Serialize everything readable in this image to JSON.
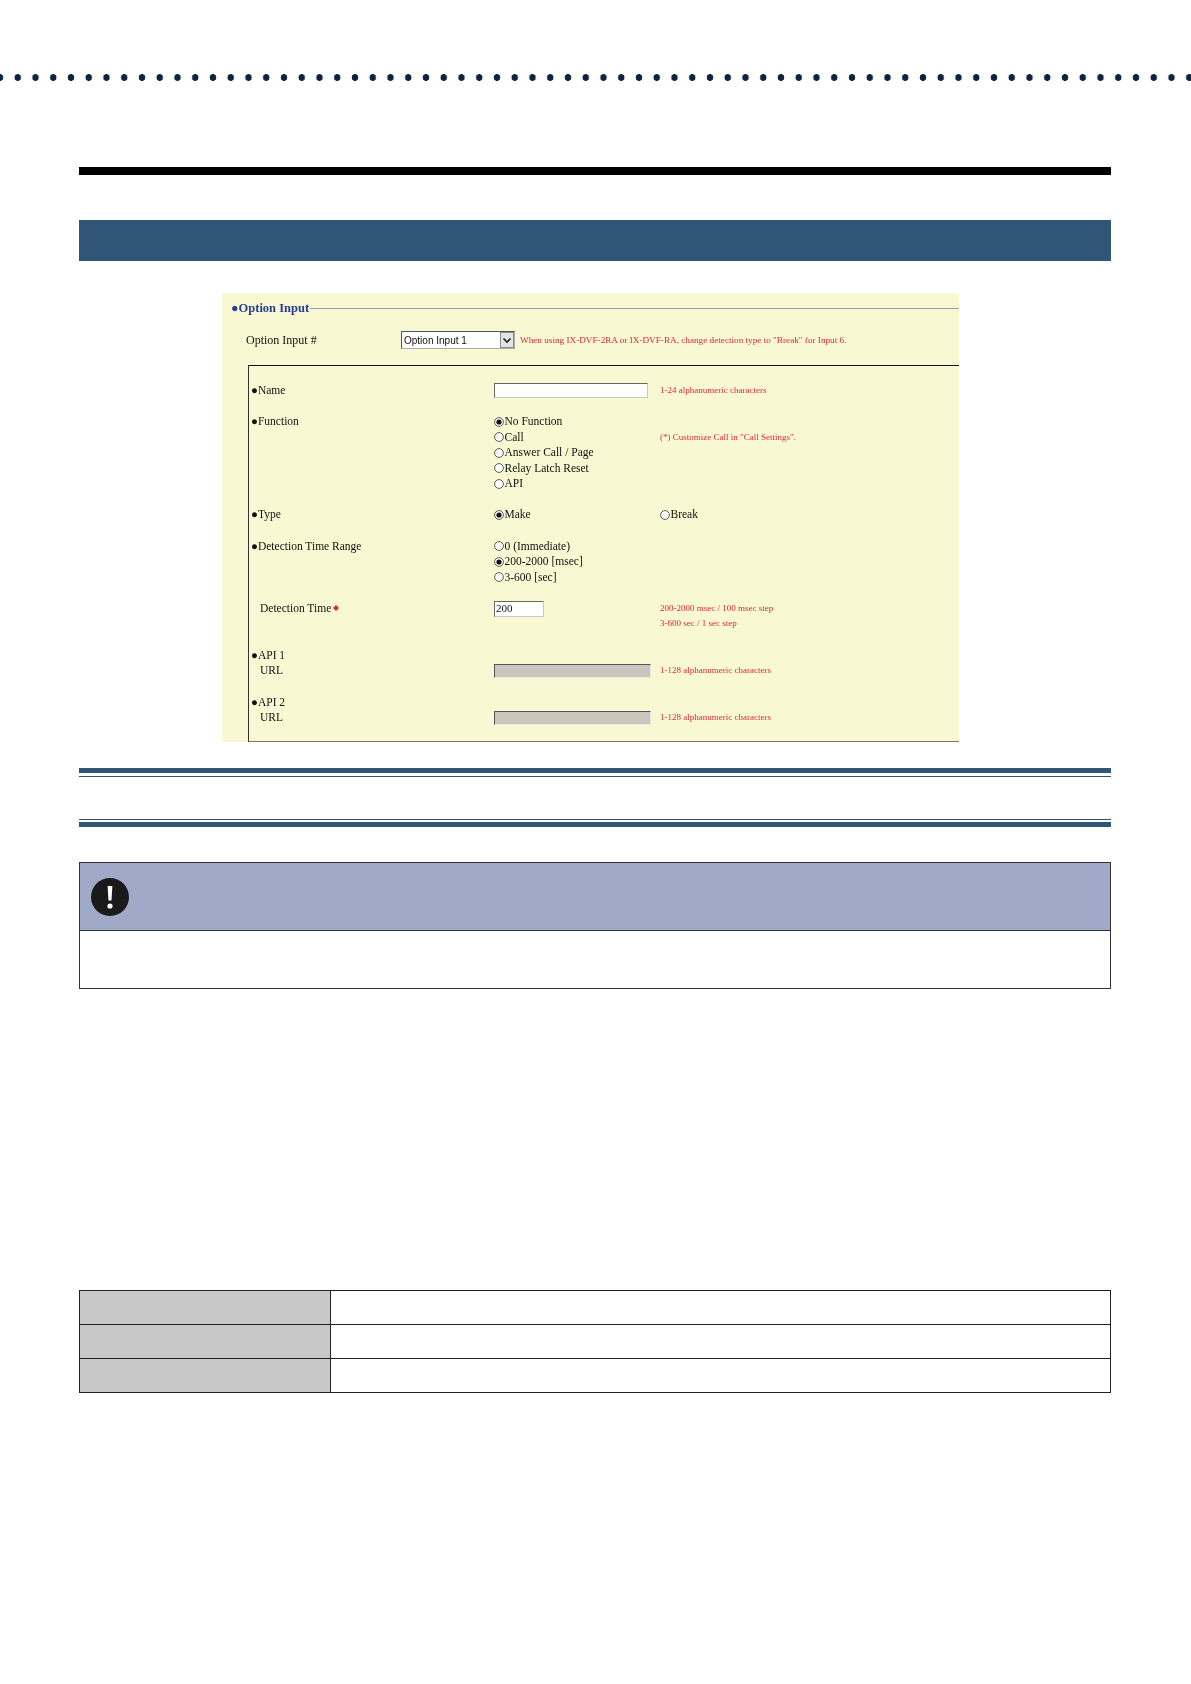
{
  "option_input_panel": {
    "title": "●Option Input",
    "selector": {
      "label": "Option Input #",
      "value": "Option Input 1",
      "note": "When using IX-DVF-2RA or IX-DVF-RA, change detection type to \"Break\" for Input 6."
    },
    "fields": [
      {
        "kind": "text",
        "label": "●Name",
        "disabled": false,
        "hints": [
          "1-24 alphanumeric characters"
        ]
      },
      {
        "kind": "radio",
        "label": "●Function",
        "options": [
          {
            "label": "No Function",
            "selected": true
          },
          {
            "label": "Call",
            "selected": false
          },
          {
            "label": "Answer Call / Page",
            "selected": false
          },
          {
            "label": "Relay Latch Reset",
            "selected": false
          },
          {
            "label": "API",
            "selected": false
          }
        ],
        "hints": [
          "(*) Customize Call in \"Call Settings\"."
        ]
      },
      {
        "kind": "radio_split",
        "label": "●Type",
        "options": [
          {
            "label": "Make",
            "selected": true
          },
          {
            "label": "Break",
            "selected": false
          }
        ]
      },
      {
        "kind": "radio",
        "label": "●Detection Time Range",
        "options": [
          {
            "label": "0 (Immediate)",
            "selected": false
          },
          {
            "label": "200-2000 [msec]",
            "selected": true
          },
          {
            "label": "3-600 [sec]",
            "selected": false
          }
        ]
      },
      {
        "kind": "number",
        "label": "Detection Time",
        "required": true,
        "disabled": false,
        "value": "200",
        "hints": [
          "200-2000 msec / 100 msec step",
          "3-600 sec / 1 sec step"
        ]
      },
      {
        "kind": "url",
        "label": "●API 1",
        "sublabel": "URL",
        "disabled": true,
        "hints": [
          "1-128 alphanumeric characters"
        ]
      },
      {
        "kind": "url",
        "label": "●API 2",
        "sublabel": "URL",
        "disabled": true,
        "hints": [
          "1-128 alphanumeric characters"
        ]
      }
    ]
  }
}
